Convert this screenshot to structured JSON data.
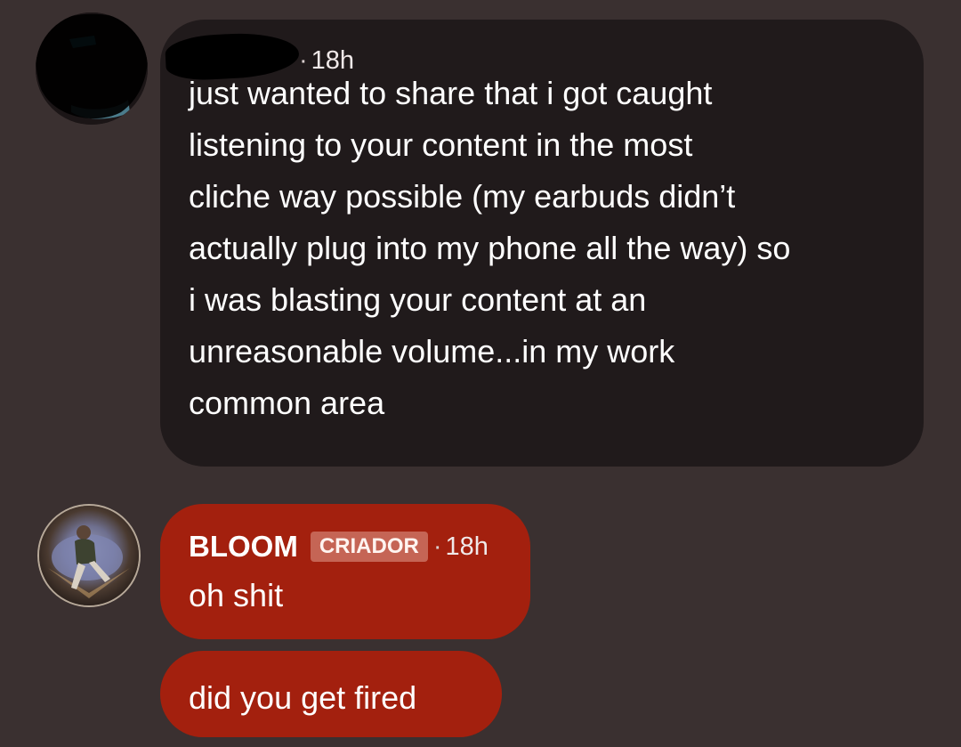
{
  "conversation": {
    "first_message": {
      "time": "18h",
      "text": "just wanted to share that i got caught listening to your content in the most cliche way possible (my earbuds didn’t actually plug into my phone all the way) so i was blasting your content at an unreasonable volume...in my work common area",
      "lines": [
        "just wanted to share that i got caught",
        "listening to your content in the most",
        "cliche way possible (my earbuds didn’t",
        "actually plug into my phone all the way) so",
        "i was blasting your content at an",
        "unreasonable volume...in my work",
        "common area"
      ]
    },
    "reply": {
      "author": "BLOOM",
      "badge": "CRIADOR",
      "separator": "·",
      "time": "18h",
      "messages": [
        "oh shit",
        "did you get fired"
      ]
    }
  },
  "colors": {
    "background": "#3a3030",
    "dark_bubble": "#201a1b",
    "red_bubble": "#a3200e",
    "badge": "#c56555"
  }
}
